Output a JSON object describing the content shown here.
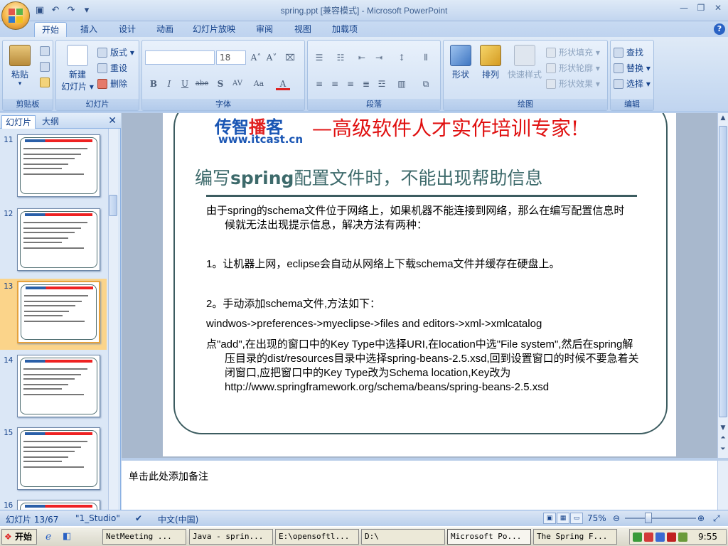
{
  "window": {
    "title": "spring.ppt [兼容模式] - Microsoft PowerPoint",
    "controls": [
      "—",
      "❐",
      "✕"
    ]
  },
  "ribbon": {
    "tabs": [
      "开始",
      "插入",
      "设计",
      "动画",
      "幻灯片放映",
      "审阅",
      "视图",
      "加载项"
    ],
    "clipboard": {
      "paste": "粘贴",
      "group": "剪贴板"
    },
    "slides": {
      "new_slide_line1": "新建",
      "new_slide_line2": "幻灯片 ▾",
      "layout": "版式 ▾",
      "reset": "重设",
      "delete": "删除",
      "group": "幻灯片"
    },
    "font": {
      "font_size": "18",
      "group": "字体",
      "bold": "B",
      "italic": "I",
      "underline": "U",
      "strike": "abe",
      "shadow": "S",
      "spacing": "AV",
      "case": "Aa",
      "color": "A"
    },
    "paragraph": {
      "group": "段落"
    },
    "drawing": {
      "shapes": "形状",
      "arrange": "排列",
      "quick_styles": "快速样式",
      "fill": "形状填充 ▾",
      "outline": "形状轮廓 ▾",
      "effects": "形状效果 ▾",
      "group": "绘图"
    },
    "editing": {
      "find": "查找",
      "replace": "替换 ▾",
      "select": "选择 ▾",
      "group": "编辑"
    }
  },
  "left_pane": {
    "tabs": [
      "幻灯片",
      "大纲"
    ],
    "close": "✕",
    "thumbnails": [
      {
        "number": "11"
      },
      {
        "number": "12"
      },
      {
        "number": "13",
        "selected": true
      },
      {
        "number": "14"
      },
      {
        "number": "15"
      },
      {
        "number": "16"
      }
    ]
  },
  "slide": {
    "brand_blue": "传智",
    "brand_red": "播",
    "brand_blue2": "客",
    "brand_url": "www.itcast.cn",
    "slogan": "—高级软件人才实作培训专家!",
    "heading_pre": "编写",
    "heading_bold": "spring",
    "heading_post": "配置文件时，不能出现帮助信息",
    "paragraphs": [
      "由于spring的schema文件位于网络上，如果机器不能连接到网络，那么在编写配置信息时候就无法出现提示信息，解决方法有两种：",
      "1。让机器上网，eclipse会自动从网络上下载schema文件并缓存在硬盘上。",
      "2。手动添加schema文件,方法如下：",
      "windwos->preferences->myeclipse->files and editors->xml->xmlcatalog",
      "点\"add\",在出现的窗口中的Key Type中选择URI,在location中选\"File system\",然后在spring解压目录的dist/resources目录中选择spring-beans-2.5.xsd,回到设置窗口的时候不要急着关闭窗口,应把窗口中的Key Type改为Schema location,Key改为http://www.springframework.org/schema/beans/spring-beans-2.5.xsd"
    ]
  },
  "notes": {
    "placeholder": "单击此处添加备注"
  },
  "status": {
    "slide": "幻灯片 13/67",
    "theme": "\"1_Studio\"",
    "language": "中文(中国)",
    "zoom": "75%"
  },
  "taskbar": {
    "start": "开始",
    "tasks": [
      "NetMeeting ...",
      "Java - sprin...",
      "E:\\opensoftl...",
      "D:\\",
      "Microsoft Po...",
      "The Spring F..."
    ],
    "clock": "9:55"
  }
}
